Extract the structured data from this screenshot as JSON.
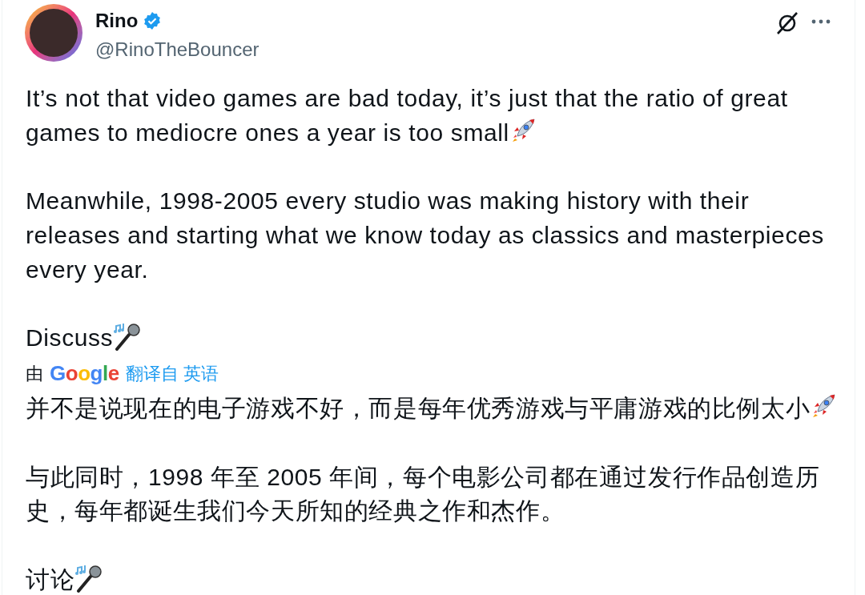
{
  "author": {
    "name": "Rino",
    "verified": true,
    "handle": "@RinoTheBouncer"
  },
  "paragraphs": [
    {
      "text": "It’s not that video games are bad today, it’s just that the ratio of great games to mediocre ones a year is too small",
      "trailing_icon": {
        "kind": "rocket"
      }
    },
    {
      "text": "Meanwhile, 1998-2005 every studio was making history with their releases and starting what we know today as classics and masterpieces every year."
    },
    {
      "text": "Discuss",
      "trailing_icon": {
        "kind": "microphone"
      }
    }
  ],
  "translation": {
    "prefix": "由",
    "provider": "Google",
    "label": "翻译自 英语",
    "paragraphs": [
      {
        "text": "并不是说现在的电子游戏不好，而是每年优秀游戏与平庸游戏的比例太小",
        "trailing_icon": {
          "kind": "rocket"
        }
      },
      {
        "text": "与此同时，1998 年至 2005 年间，每个电影公司都在通过发行作品创造历史，每年都诞生我们今天所知的经典之作和杰作。"
      },
      {
        "text": "讨论",
        "trailing_icon": {
          "kind": "microphone"
        }
      }
    ]
  }
}
